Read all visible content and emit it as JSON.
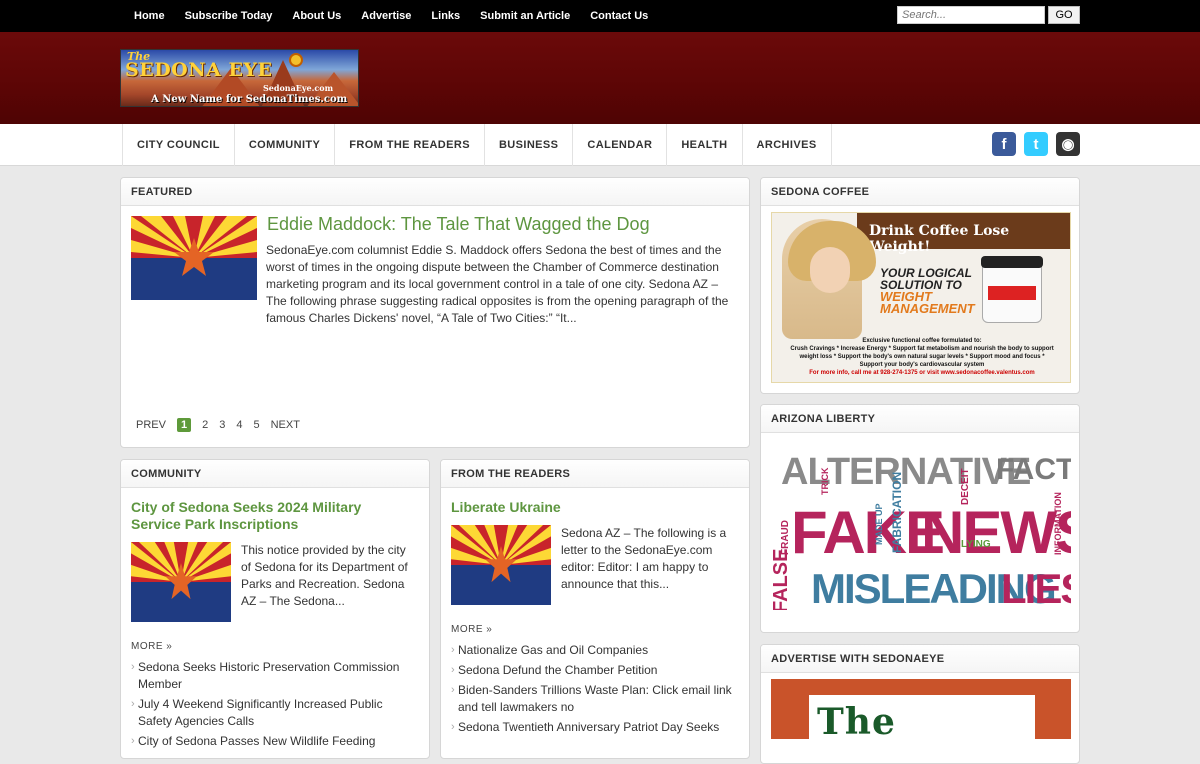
{
  "topnav": {
    "items": [
      "Home",
      "Subscribe Today",
      "About Us",
      "Advertise",
      "Links",
      "Submit an Article",
      "Contact Us"
    ],
    "search_placeholder": "Search...",
    "search_button": "GO"
  },
  "logo": {
    "line1": "The",
    "line2": "SEDONA EYE",
    "line3": "SedonaEye.com",
    "line4": "A New Name for SedonaTimes.com"
  },
  "catnav": [
    "CITY COUNCIL",
    "COMMUNITY",
    "FROM THE READERS",
    "BUSINESS",
    "CALENDAR",
    "HEALTH",
    "ARCHIVES"
  ],
  "social": {
    "facebook": "f",
    "twitter": "t",
    "rss": "◉"
  },
  "featured": {
    "heading": "FEATURED",
    "title": "Eddie Maddock: The Tale That Wagged the Dog",
    "excerpt": "SedonaEye.com columnist Eddie S. Maddock offers Sedona the best of times and the worst of times in the ongoing dispute between the Chamber of Commerce destination marketing program and its local government control in a tale of one city. Sedona AZ – The following phrase suggesting radical opposites is from the opening paragraph of the famous Charles Dickens' novel, “A Tale of Two Cities:” “It...",
    "pager": {
      "prev": "PREV",
      "pages": [
        "1",
        "2",
        "3",
        "4",
        "5"
      ],
      "current": "1",
      "next": "NEXT"
    }
  },
  "community": {
    "heading": "COMMUNITY",
    "title": "City of Sedona Seeks 2024 Military Service Park Inscriptions",
    "excerpt": "This notice provided by the city of Sedona for its Department of Parks and Recreation. Sedona AZ – The Sedona...",
    "more": "MORE »",
    "links": [
      "Sedona Seeks Historic Preservation Commission Member",
      "July 4 Weekend Significantly Increased Public Safety Agencies Calls",
      "City of Sedona Passes New Wildlife Feeding"
    ]
  },
  "readers": {
    "heading": "FROM THE READERS",
    "title": "Liberate Ukraine",
    "excerpt": "Sedona AZ – The following is a letter to the SedonaEye.com editor: Editor: I am happy to announce that this...",
    "more": "MORE »",
    "links": [
      "Nationalize Gas and Oil Companies",
      "Sedona Defund the Chamber Petition",
      "Biden-Sanders Trillions Waste Plan: Click email link and tell lawmakers no",
      "Sedona Twentieth Anniversary Patriot Day Seeks"
    ]
  },
  "sidebar": {
    "coffee_heading": "SEDONA COFFEE",
    "coffee_banner": "Drink Coffee Lose Weight!",
    "coffee_slogan_1": "YOUR LOGICAL",
    "coffee_slogan_2": "SOLUTION TO",
    "coffee_slogan_3": "WEIGHT",
    "coffee_slogan_4": "MANAGEMENT",
    "coffee_fine_1": "Exclusive functional coffee formulated to:",
    "coffee_fine_2": "Crush Cravings * Increase Energy * Support fat metabolism and nourish the body to support",
    "coffee_fine_3": "weight loss * Support the body's own natural sugar levels * Support mood and focus *",
    "coffee_fine_4": "Support your body's cardiovascular system",
    "coffee_fine_5": "For more info, call me at 928-274-1375 or visit www.sedonacoffee.valentus.com",
    "liberty_heading": "ARIZONA LIBERTY",
    "cloud": {
      "w1": "ALTERNATIVE",
      "w2": "FACTS",
      "w3": "FAKE",
      "w4": "NEWS",
      "w5": "MISLEADING",
      "w6": "LIES",
      "w7": "FALSE",
      "w8": "FABRICATION",
      "w9": "FRAUD",
      "w10": "DECEIT",
      "w11": "LYING",
      "w12": "INFORMATION",
      "w13": "MADE UP",
      "w14": "TRICK"
    },
    "advertise_heading": "ADVERTISE WITH SEDONAEYE",
    "advertise_logo": "The Sedona"
  },
  "colors": {
    "accent_green": "#5e9640",
    "header_maroon": "#5c0505",
    "topbar": "#000000"
  }
}
